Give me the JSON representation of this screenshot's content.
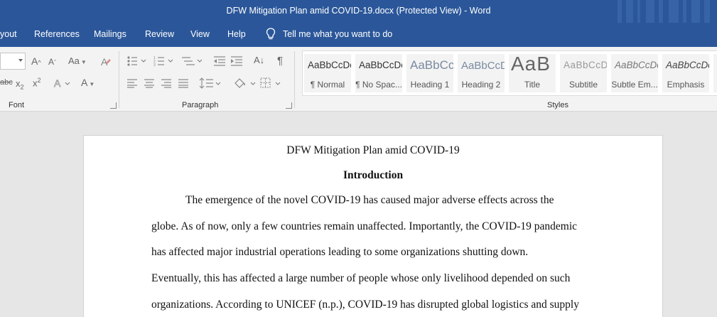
{
  "window": {
    "title": "DFW Mitigation Plan amid COVID-19.docx (Protected View)  -  Word"
  },
  "menu": {
    "items": [
      {
        "label": "yout"
      },
      {
        "label": "References"
      },
      {
        "label": "Mailings"
      },
      {
        "label": "Review"
      },
      {
        "label": "View"
      },
      {
        "label": "Help"
      }
    ],
    "tell_me": "Tell me what you want to do"
  },
  "ribbon": {
    "font": {
      "label": "Font",
      "grow": "A",
      "shrink": "A",
      "change_case": "Aa",
      "strike": "abc",
      "subscript": "x",
      "superscript": "x",
      "subscript_mark": "2",
      "superscript_mark": "2",
      "effects": "A",
      "color": "A"
    },
    "paragraph": {
      "label": "Paragraph",
      "sort": "A↓",
      "pilcrow": "¶"
    },
    "styles": {
      "label": "Styles",
      "items": [
        {
          "sample": "AaBbCcDc",
          "name": "¶ Normal"
        },
        {
          "sample": "AaBbCcDc",
          "name": "¶ No Spac..."
        },
        {
          "sample": "AaBbCc",
          "name": "Heading 1"
        },
        {
          "sample": "AaBbCcD",
          "name": "Heading 2"
        },
        {
          "sample": "AaB",
          "name": "Title"
        },
        {
          "sample": "AaBbCcD",
          "name": "Subtitle"
        },
        {
          "sample": "AaBbCcDc",
          "name": "Subtle Em..."
        },
        {
          "sample": "AaBbCcDc",
          "name": "Emphasis"
        }
      ]
    }
  },
  "document": {
    "title": "DFW Mitigation Plan amid COVID-19",
    "section_heading": "Introduction",
    "lines": [
      "The emergence of the novel COVID-19 has caused major adverse effects across the",
      "globe. As of now, only a few countries remain unaffected. Importantly, the COVID-19 pandemic",
      "has affected major industrial operations leading to some organizations shutting down.",
      "Eventually, this has affected a large number of people whose only livelihood depended on such",
      "organizations. According to UNICEF (n.p.), COVID-19 has disrupted global logistics and supply"
    ]
  },
  "colors": {
    "brand": "#2b579a",
    "ribbon": "#f3f3f3",
    "canvas": "#e6e6e6"
  }
}
